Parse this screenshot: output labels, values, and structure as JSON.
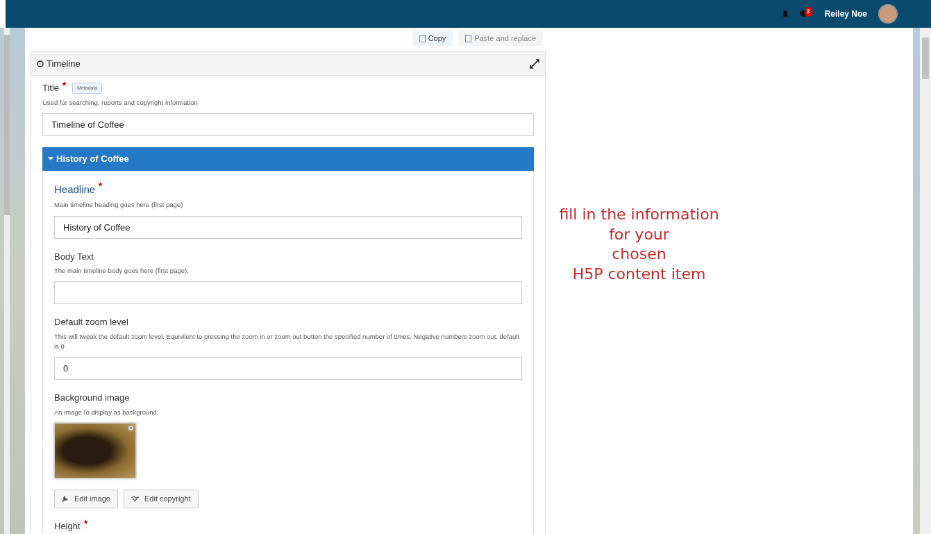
{
  "navbar": {
    "notification_count": "2",
    "user_name": "Reiley Noe"
  },
  "toolbar": [
    {
      "label": "Copy",
      "disabled": false
    },
    {
      "label": "Paste and replace",
      "disabled": true
    }
  ],
  "editor": {
    "title": "Timeline",
    "title_field": {
      "label": "Title",
      "required": true,
      "metadata": "Metadata",
      "description": "Used for searching, reports and copyright information",
      "value": "Timeline of Coffee"
    },
    "group": {
      "label": "History of Coffee",
      "expanded": true,
      "fields": [
        {
          "kind": "text",
          "label": "Headline",
          "required": true,
          "description": "Main timeline heading goes here (first page)",
          "value": "History of Coffee"
        },
        {
          "kind": "text",
          "label": "Body Text",
          "required": false,
          "description": "The main timeline body goes here (first page)."
        },
        {
          "kind": "text",
          "label": "Default zoom level",
          "required": false,
          "description": "This will tweak the default zoom level. Equivilent to pressing the zoom in or zoom out button the specified number of times. Negative numbers zoom out. default is 0",
          "value": "0"
        },
        {
          "kind": "image",
          "label": "Background image",
          "required": false,
          "description": "An image to display as background.",
          "buttons": [
            "Edit image",
            "Edit copyright"
          ]
        },
        {
          "kind": "label",
          "label": "Height",
          "required": true
        }
      ]
    }
  },
  "annotation": [
    "fill in the information",
    "for your",
    "chosen",
    "H5P content item"
  ]
}
